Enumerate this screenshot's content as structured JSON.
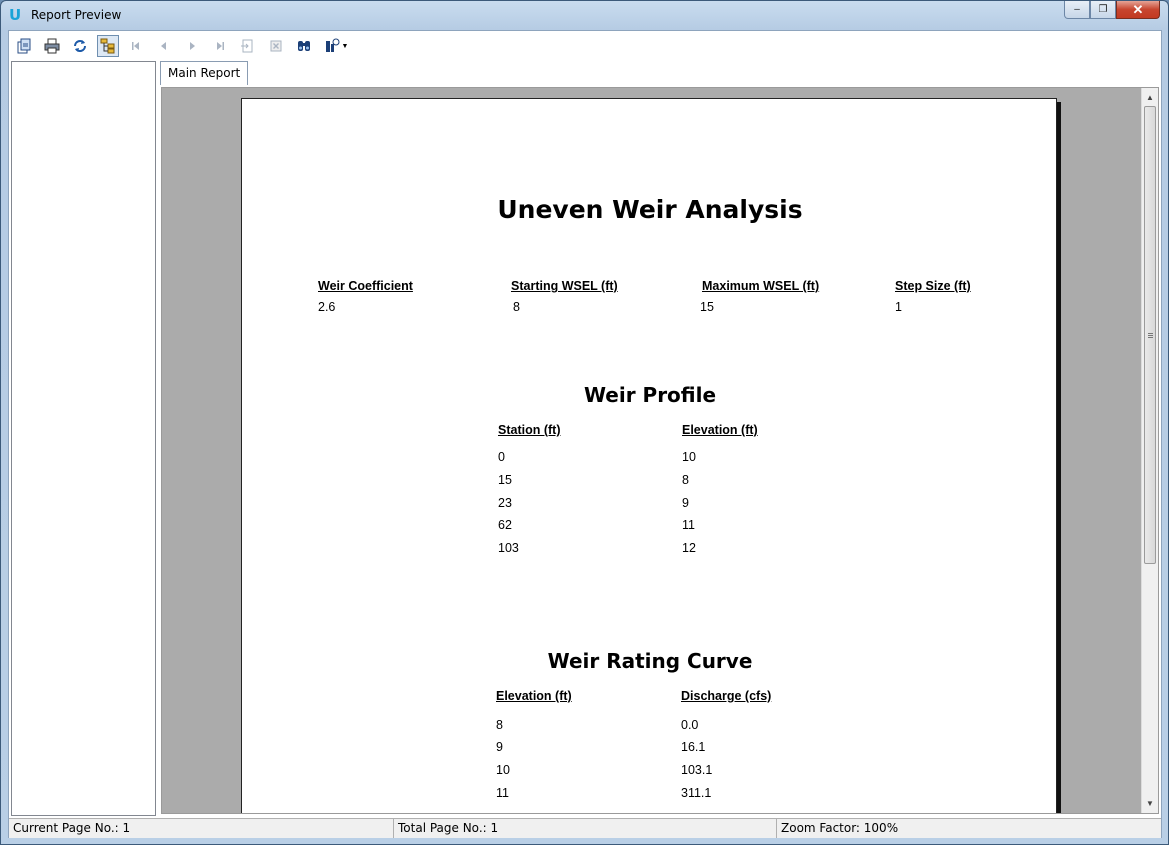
{
  "window": {
    "title": "Report Preview",
    "app_icon_glyph": "U",
    "app_icon_color": "#1aa3d8",
    "controls": {
      "minimize": "‒",
      "maximize": "❐",
      "close": "✕"
    }
  },
  "toolbar": {
    "icons": [
      "export-icon",
      "print-icon",
      "refresh-icon",
      "group-tree-icon",
      "first-page-icon",
      "previous-page-icon",
      "next-page-icon",
      "last-page-icon",
      "go-to-page-icon",
      "stop-icon",
      "find-icon",
      "zoom-icon",
      "zoom-dropdown-icon"
    ]
  },
  "tabs": [
    "Main Report"
  ],
  "report": {
    "title": "Uneven Weir Analysis",
    "params": {
      "headers": [
        "Weir Coefficient",
        "Starting WSEL (ft)",
        "Maximum WSEL (ft)",
        "Step Size (ft)"
      ],
      "values": [
        "2.6",
        "8",
        "15",
        "1"
      ]
    },
    "profile": {
      "title": "Weir Profile",
      "headers": [
        "Station (ft)",
        "Elevation (ft)"
      ],
      "rows": [
        [
          "0",
          "10"
        ],
        [
          "15",
          "8"
        ],
        [
          "23",
          "9"
        ],
        [
          "62",
          "11"
        ],
        [
          "103",
          "12"
        ]
      ]
    },
    "rating": {
      "title": "Weir Rating Curve",
      "headers": [
        "Elevation (ft)",
        "Discharge (cfs)"
      ],
      "rows": [
        [
          "8",
          "0.0"
        ],
        [
          "9",
          "16.1"
        ],
        [
          "10",
          "103.1"
        ],
        [
          "11",
          "311.1"
        ]
      ]
    }
  },
  "status": {
    "current_page": "Current Page No.: 1",
    "total_page": "Total Page No.: 1",
    "zoom": "Zoom Factor: 100%"
  }
}
